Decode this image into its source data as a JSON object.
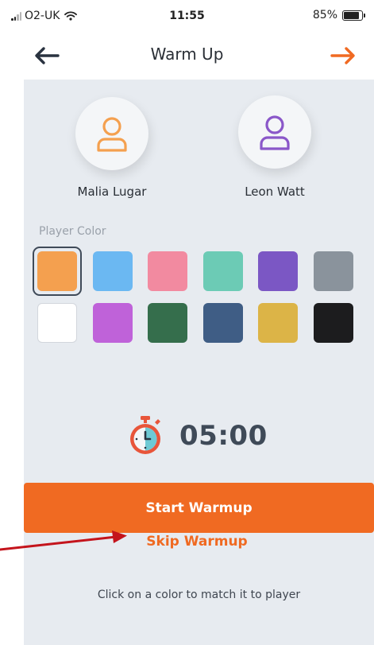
{
  "status_bar": {
    "carrier": "O2-UK",
    "time": "11:55",
    "battery": "85%",
    "battery_level": 0.85
  },
  "header": {
    "title": "Warm Up",
    "back_icon": "arrow-left-icon",
    "forward_icon": "arrow-right-icon",
    "forward_color": "#f06a22"
  },
  "players": [
    {
      "name": "Malia Lugar",
      "ring_color": "#f4a04f"
    },
    {
      "name": "Leon Watt",
      "ring_color": "#8a57c9"
    }
  ],
  "color_picker": {
    "label": "Player Color",
    "selected": "#f4a04f",
    "colors": [
      "#f4a04f",
      "#6bb8f2",
      "#f28aa0",
      "#6ccbb5",
      "#7b57c4",
      "#8a939c",
      "#ffffff",
      "#bf62d9",
      "#356e4c",
      "#3f5d85",
      "#dcb447",
      "#1c1c1e"
    ]
  },
  "timer": {
    "value": "05:00",
    "icon": "stopwatch-icon"
  },
  "actions": {
    "start_label": "Start Warmup",
    "skip_label": "Skip Warmup"
  },
  "hint": "Click on a color to match it to player",
  "annotation": {
    "arrow_color": "#c4141c"
  }
}
